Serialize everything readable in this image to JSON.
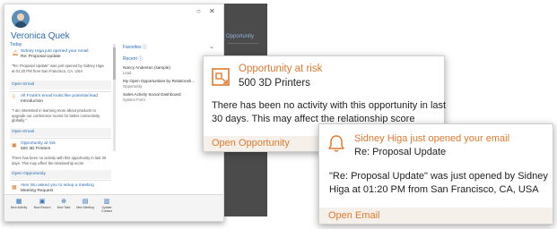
{
  "user": {
    "name": "Veronica Quek"
  },
  "window": {
    "restore_glyph": "○",
    "close_glyph": "✕"
  },
  "sections": {
    "today": "Today",
    "favorites": "Favorites ⓘ",
    "recent": "Recent ⓘ",
    "chevron": "⌄"
  },
  "background_hint": "Opportunity",
  "cards": [
    {
      "icon": "bell-icon",
      "title": "Sidney Higa just opened your email",
      "subtitle": "Re: Proposal Update",
      "body": "\"Re: Proposal Update\" was just opened by Sidney Higa at 01:20 PM from San Francisco, CA, USA",
      "action": "Open Email"
    },
    {
      "icon": "lightbulb-icon",
      "title": "All Frank's email looks like potential lead",
      "subtitle": "Introduction",
      "body": "\"I am interested in learning more about products to upgrade our conference rooms for better connectivity globally.\"",
      "action": "Open Email"
    },
    {
      "icon": "opportunity-icon",
      "title": "Opportunity at risk",
      "subtitle": "500 3D Printers",
      "body": "There has been no activity with this opportunity in last 30 days. This may affect the relationship score",
      "action": "Open Opportunity"
    },
    {
      "icon": "calendar-icon",
      "title": "Alex Wu asked you to setup a meeting",
      "subtitle": "Meeting Request",
      "body": "",
      "action": ""
    }
  ],
  "recent": [
    {
      "name": "Nancy Anderson (sample)",
      "type": "Lead"
    },
    {
      "name": "My Open Opportunities by Relationsh...",
      "type": "Opportunity"
    },
    {
      "name": "Sales Activity Social Dashboard",
      "type": "System Form"
    }
  ],
  "bottom_bar": [
    {
      "icon": "new-activity-icon",
      "glyph": "▦",
      "label": "New Activity"
    },
    {
      "icon": "new-record-icon",
      "glyph": "▣",
      "label": "New Record"
    },
    {
      "icon": "new-task-icon",
      "glyph": "⊕",
      "label": "New Task"
    },
    {
      "icon": "new-meeting-icon",
      "glyph": "▤",
      "label": "New Meeting"
    },
    {
      "icon": "update-contact-icon",
      "glyph": "▥",
      "label": "Update Contact"
    }
  ],
  "callout_opportunity": {
    "title": "Opportunity at risk",
    "subtitle": "500 3D Printers",
    "body": "There has been no activity with this opportunity in last 30 days. This may affect the relationship score",
    "action": "Open Opportunity"
  },
  "callout_email": {
    "title": "Sidney Higa just opened your email",
    "subtitle": "Re: Proposal Update",
    "body": "\"Re: Proposal Update\" was just opened by Sidney Higa at 01:20 PM from San Francisco, CA, USA",
    "action": "Open Email"
  },
  "colors": {
    "accent": "#e07a2f",
    "link": "#2a6cb6",
    "footer_bg": "#f5f0ea"
  }
}
